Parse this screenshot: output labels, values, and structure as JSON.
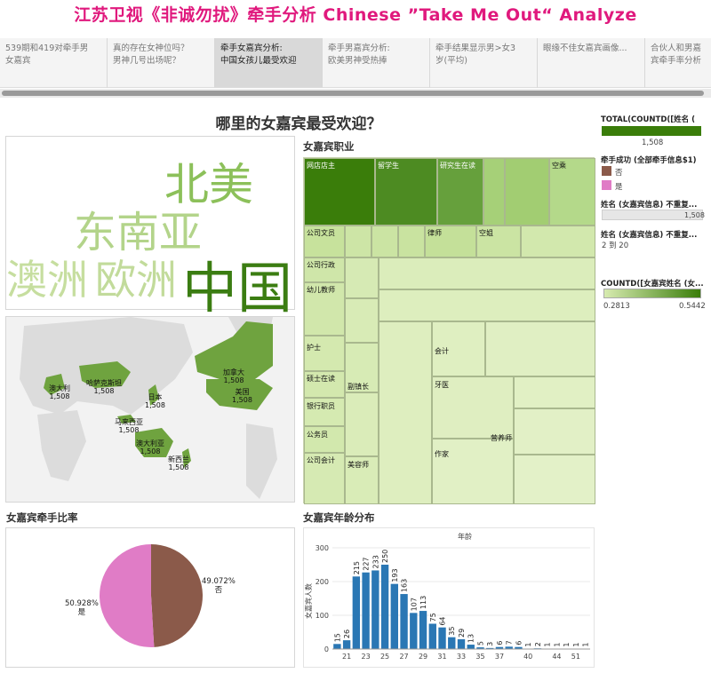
{
  "header": {
    "title": "江苏卫视《非诚勿扰》牵手分析  Chinese ”Take Me Out“ Analyze"
  },
  "tabs": [
    {
      "label": "539期和419对牵手男\n女嘉宾",
      "active": false
    },
    {
      "label": "真的存在女神位吗？\n男神几号出场呢？",
      "active": false
    },
    {
      "label": "牵手女嘉宾分析:\n中国女孩儿最受欢迎",
      "active": true
    },
    {
      "label": "牵手男嘉宾分析:\n欧美男神受热捧",
      "active": false
    },
    {
      "label": "牵手结果显示男>女3\n岁(平均)",
      "active": false
    },
    {
      "label": "眼缘不佳女嘉宾画像...",
      "active": false
    },
    {
      "label": "合伙人和男嘉\n宾牵手率分析",
      "active": false
    }
  ],
  "dashboard": {
    "title": "哪里的女嘉宾最受欢迎？",
    "word_cloud": [
      {
        "text": "北美",
        "color": "#8cc05a"
      },
      {
        "text": "东南亚",
        "color": "#b3d48a"
      },
      {
        "text": "澳洲",
        "color": "#c6de9f"
      },
      {
        "text": "欧洲",
        "color": "#c2db9b"
      },
      {
        "text": "中国",
        "color": "#3b7d12"
      }
    ],
    "map_labels": [
      {
        "name": "澳大利",
        "value": "1,508"
      },
      {
        "name": "哈萨克斯坦",
        "value": "1,508"
      },
      {
        "name": "日本",
        "value": "1,508"
      },
      {
        "name": "马来西亚",
        "value": "1,508"
      },
      {
        "name": "澳大利亚",
        "value": "1,508"
      },
      {
        "name": "新西兰",
        "value": "1,508"
      },
      {
        "name": "加拿大",
        "value": "1,508"
      },
      {
        "name": "美国",
        "value": "1,508"
      }
    ],
    "occupation": {
      "title": "女嘉宾职业",
      "labels": [
        "网店店主",
        "留学生",
        "研究生在读",
        "空乘",
        "公司文员",
        "律师",
        "空姐",
        "公司行政",
        "幼儿教师",
        "护士",
        "会计",
        "硕士在读",
        "副镇长",
        "牙医",
        "银行职员",
        "公务员",
        "作家",
        "公司会计",
        "美容师",
        "营养师"
      ]
    },
    "pie": {
      "title": "女嘉宾牵手比率",
      "slices": [
        {
          "label": "否",
          "percent": "49.072%",
          "value": 49.072,
          "color": "#8b5a4a"
        },
        {
          "label": "是",
          "percent": "50.928%",
          "value": 50.928,
          "color": "#e07cc6"
        }
      ]
    },
    "age": {
      "title": "女嘉宾年龄分布"
    }
  },
  "legend": {
    "total_title": "TOTAL(COUNTD([姓名 (",
    "total_value": "1,508",
    "match_title": "牵手成功 (全部牵手信息$1)",
    "match_items": [
      {
        "label": "否",
        "color": "#8b5a4a"
      },
      {
        "label": "是",
        "color": "#e07cc6"
      }
    ],
    "filter1_title": "姓名 (女嘉宾信息) 不重复...",
    "filter1_value": "1,508",
    "filter2_title": "姓名 (女嘉宾信息) 不重复...",
    "filter2_value": "2 到 20",
    "gradient_title": "COUNTD([女嘉宾姓名 (女...",
    "gradient_min": "0.2813",
    "gradient_max": "0.5442",
    "colors": {
      "dark": "#3a7d0a",
      "light": "#d7ebb0"
    }
  },
  "chart_data": {
    "type": "bar",
    "title": "年龄",
    "ylabel": "女嘉宾人数",
    "xlabel": "",
    "x": [
      20,
      21,
      22,
      23,
      24,
      25,
      26,
      27,
      28,
      29,
      30,
      31,
      32,
      33,
      34,
      35,
      36,
      37,
      38,
      39,
      40,
      41,
      42,
      44,
      48,
      51,
      54
    ],
    "values": [
      15,
      26,
      215,
      227,
      233,
      250,
      193,
      163,
      107,
      113,
      75,
      64,
      35,
      29,
      13,
      5,
      3,
      6,
      7,
      6,
      1,
      2,
      1,
      1,
      1,
      1,
      1
    ],
    "x_ticks": [
      "21",
      "23",
      "25",
      "27",
      "29",
      "31",
      "33",
      "35",
      "37",
      "40",
      "44",
      "51"
    ],
    "ylim": [
      0,
      300
    ],
    "y_ticks": [
      0,
      100,
      200,
      300
    ],
    "color": "#2a77b4"
  }
}
